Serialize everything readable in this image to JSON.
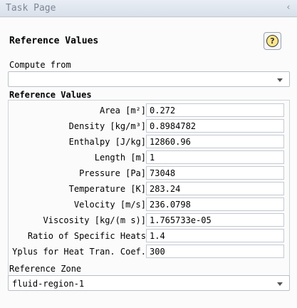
{
  "window": {
    "title": "Task Page",
    "collapse_glyph": "‹"
  },
  "panel": {
    "heading": "Reference Values",
    "help_glyph": "?",
    "compute_from": {
      "label": "Compute from",
      "value": ""
    },
    "reference_values": {
      "group_label": "Reference Values",
      "rows": [
        {
          "label": "Area [m²]",
          "value": "0.272"
        },
        {
          "label": "Density [kg/m³]",
          "value": "0.8984782"
        },
        {
          "label": "Enthalpy [J/kg]",
          "value": "12860.96"
        },
        {
          "label": "Length [m]",
          "value": "1"
        },
        {
          "label": "Pressure [Pa]",
          "value": "73048"
        },
        {
          "label": "Temperature [K]",
          "value": "283.24"
        },
        {
          "label": "Velocity [m/s]",
          "value": "236.0798"
        },
        {
          "label": "Viscosity [kg/(m s)]",
          "value": "1.765733e-05"
        },
        {
          "label": "Ratio of Specific Heats",
          "value": "1.4"
        },
        {
          "label": "Yplus for Heat Tran. Coef.",
          "value": "300"
        }
      ]
    },
    "reference_zone": {
      "label": "Reference Zone",
      "value": "fluid-region-1"
    }
  }
}
